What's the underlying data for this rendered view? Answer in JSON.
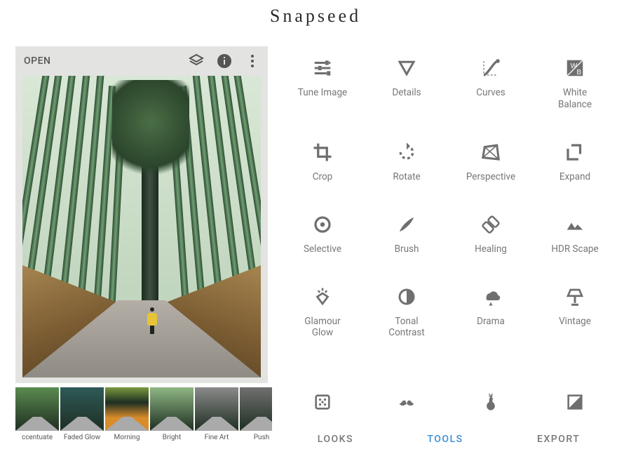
{
  "app_title": "Snapseed",
  "phone": {
    "open_label": "OPEN",
    "top_icons": [
      "layers-icon",
      "info-icon",
      "more-icon"
    ]
  },
  "looks": [
    {
      "label": "ccentuate",
      "tint": "#5a8a4e"
    },
    {
      "label": "Faded Glow",
      "tint": "#2e5a58"
    },
    {
      "label": "Morning",
      "tint": "#7a9a3e",
      "accent": "#d88c2a"
    },
    {
      "label": "Bright",
      "tint": "#8fb784"
    },
    {
      "label": "Fine Art",
      "tint": "#8a8a8a"
    },
    {
      "label": "Push",
      "tint": "#707070"
    }
  ],
  "tools": [
    {
      "name": "tune-image",
      "label": "Tune Image",
      "icon": "sliders-icon"
    },
    {
      "name": "details",
      "label": "Details",
      "icon": "triangle-down-icon"
    },
    {
      "name": "curves",
      "label": "Curves",
      "icon": "curves-icon"
    },
    {
      "name": "white-balance",
      "label": "White Balance",
      "icon": "wb-icon"
    },
    {
      "name": "crop",
      "label": "Crop",
      "icon": "crop-icon"
    },
    {
      "name": "rotate",
      "label": "Rotate",
      "icon": "rotate-icon"
    },
    {
      "name": "perspective",
      "label": "Perspective",
      "icon": "perspective-icon"
    },
    {
      "name": "expand",
      "label": "Expand",
      "icon": "expand-icon"
    },
    {
      "name": "selective",
      "label": "Selective",
      "icon": "target-icon"
    },
    {
      "name": "brush",
      "label": "Brush",
      "icon": "brush-icon"
    },
    {
      "name": "healing",
      "label": "Healing",
      "icon": "bandaid-icon"
    },
    {
      "name": "hdr-scape",
      "label": "HDR Scape",
      "icon": "mountains-icon"
    },
    {
      "name": "glamour-glow",
      "label": "Glamour Glow",
      "icon": "diamond-shine-icon"
    },
    {
      "name": "tonal-contrast",
      "label": "Tonal Contrast",
      "icon": "half-circle-icon"
    },
    {
      "name": "drama",
      "label": "Drama",
      "icon": "cloud-drop-icon"
    },
    {
      "name": "vintage",
      "label": "Vintage",
      "icon": "lamp-icon"
    }
  ],
  "bottom_row": [
    {
      "name": "grainy-film",
      "icon": "dice-icon"
    },
    {
      "name": "retrolux",
      "icon": "moustache-icon"
    },
    {
      "name": "grunge",
      "icon": "guitar-icon"
    },
    {
      "name": "bw",
      "icon": "contrast-square-icon"
    }
  ],
  "tabs": {
    "looks": "LOOKS",
    "tools": "TOOLS",
    "export": "EXPORT",
    "active": "tools"
  }
}
